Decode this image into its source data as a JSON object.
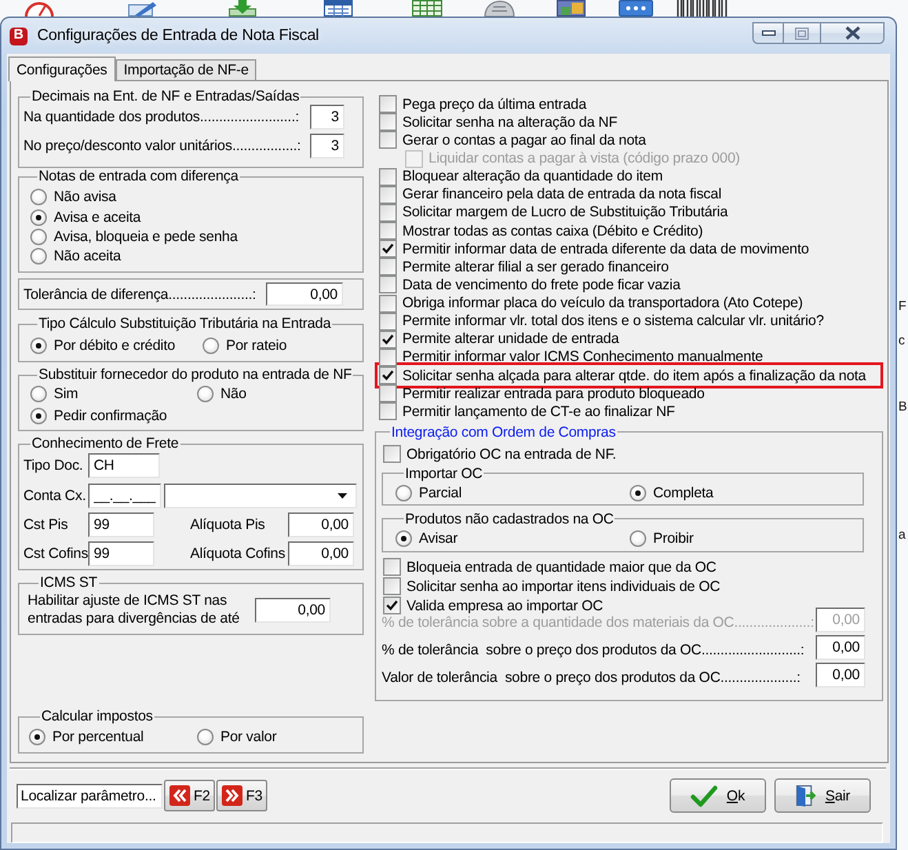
{
  "window": {
    "title": "Configurações de Entrada de Nota Fiscal",
    "logo": "B"
  },
  "background": {
    "fragments": [
      "F",
      "c",
      "B",
      "a"
    ]
  },
  "tabs": [
    {
      "label": "Configurações",
      "selected": true
    },
    {
      "label": "Importação de NF-e",
      "selected": false
    }
  ],
  "decimals": {
    "title": "Decimais na Ent. de NF e Entradas/Saídas",
    "fields": [
      {
        "label": "Na quantidade dos produtos.........................:",
        "value": "3"
      },
      {
        "label": "No preço/desconto valor unitários.................:",
        "value": "3"
      }
    ]
  },
  "difference_notes": {
    "title": "Notas de entrada com diferença",
    "options": [
      {
        "label": "Não avisa",
        "selected": false
      },
      {
        "label": "Avisa e aceita",
        "selected": true
      },
      {
        "label": "Avisa, bloqueia e pede senha",
        "selected": false
      },
      {
        "label": "Não aceita",
        "selected": false
      }
    ]
  },
  "tolerance": {
    "label": "Tolerância de diferença......................:",
    "value": "0,00"
  },
  "st_calculation": {
    "title": "Tipo Cálculo Substituição Tributária na Entrada",
    "options": [
      {
        "label": "Por débito e crédito",
        "selected": true
      },
      {
        "label": "Por rateio",
        "selected": false
      }
    ]
  },
  "supplier_replacement": {
    "title": "Substituir fornecedor do produto na entrada de NF",
    "options": [
      {
        "label": "Sim",
        "selected": false
      },
      {
        "label": "Não",
        "selected": false
      },
      {
        "label": "Pedir confirmação",
        "selected": true
      }
    ]
  },
  "freight": {
    "title": "Conhecimento de Frete",
    "doc_type": {
      "label": "Tipo Doc.",
      "value": "CH"
    },
    "cash_account": {
      "label": "Conta Cx.",
      "value": "__.__.___"
    },
    "taxes": [
      {
        "code_label": "Cst Pis",
        "code": "99",
        "rate_label": "Alíquota Pis",
        "rate": "0,00"
      },
      {
        "code_label": "Cst Cofins",
        "code": "99",
        "rate_label": "Alíquota Cofins",
        "rate": "0,00"
      }
    ]
  },
  "icms_st": {
    "title": "ICMS ST",
    "label": "Habilitar ajuste de ICMS ST nas entradas para divergências de até",
    "value": "0,00"
  },
  "tax_calculation": {
    "title": "Calcular impostos",
    "options": [
      {
        "label": "Por percentual",
        "selected": true
      },
      {
        "label": "Por valor",
        "selected": false
      }
    ]
  },
  "options": [
    {
      "label": "Pega preço da última entrada",
      "checked": false,
      "disabled": false,
      "highlighted": false
    },
    {
      "label": "Solicitar senha na alteração da NF",
      "checked": false,
      "disabled": false,
      "highlighted": false
    },
    {
      "label": "Gerar o contas a pagar ao final da nota",
      "checked": false,
      "disabled": false,
      "highlighted": false,
      "children": [
        {
          "label": "Liquidar contas a pagar à vista (código prazo 000)",
          "checked": false,
          "disabled": true,
          "highlighted": false
        }
      ]
    },
    {
      "label": "Bloquear alteração da quantidade do item",
      "checked": false,
      "disabled": false,
      "highlighted": false
    },
    {
      "label": "Gerar financeiro pela data de entrada da nota fiscal",
      "checked": false,
      "disabled": false,
      "highlighted": false
    },
    {
      "label": "Solicitar margem de Lucro de Substituição Tributária",
      "checked": false,
      "disabled": false,
      "highlighted": false
    },
    {
      "label": "Mostrar todas as contas caixa (Débito e Crédito)",
      "checked": false,
      "disabled": false,
      "highlighted": false
    },
    {
      "label": "Permitir informar data de entrada diferente da data de movimento",
      "checked": true,
      "disabled": false,
      "highlighted": false
    },
    {
      "label": "Permite alterar filial a ser gerado financeiro",
      "checked": false,
      "disabled": false,
      "highlighted": false
    },
    {
      "label": "Data de vencimento do frete pode ficar vazia",
      "checked": false,
      "disabled": false,
      "highlighted": false
    },
    {
      "label": "Obriga informar placa do veículo da transportadora (Ato Cotepe)",
      "checked": false,
      "disabled": false,
      "highlighted": false
    },
    {
      "label": "Permite informar vlr. total dos itens e o sistema calcular vlr. unitário?",
      "checked": false,
      "disabled": false,
      "highlighted": false
    },
    {
      "label": "Permite alterar unidade de entrada",
      "checked": true,
      "disabled": false,
      "highlighted": false
    },
    {
      "label": "Permitir informar valor ICMS Conhecimento manualmente",
      "checked": false,
      "disabled": false,
      "highlighted": false
    },
    {
      "label": "Solicitar senha alçada para alterar qtde. do item após a finalização da nota",
      "checked": true,
      "disabled": false,
      "highlighted": true
    },
    {
      "label": "Permitir realizar entrada para produto bloqueado",
      "checked": false,
      "disabled": false,
      "highlighted": false
    },
    {
      "label": "Permitir lançamento de CT-e ao finalizar NF",
      "checked": false,
      "disabled": false,
      "highlighted": false
    }
  ],
  "purchase_order": {
    "title": "Integração com Ordem de Compras",
    "required": {
      "label": "Obrigatório OC na entrada de NF.",
      "checked": false
    },
    "import_mode": {
      "title": "Importar OC",
      "options": [
        {
          "label": "Parcial",
          "selected": false
        },
        {
          "label": "Completa",
          "selected": true
        }
      ]
    },
    "unregistered_products": {
      "title": "Produtos não cadastrados na OC",
      "options": [
        {
          "label": "Avisar",
          "selected": true
        },
        {
          "label": "Proibir",
          "selected": false
        }
      ]
    },
    "checks": [
      {
        "label": "Bloqueia entrada de quantidade maior que da OC",
        "checked": false
      },
      {
        "label": "Solicitar senha ao importar itens individuais de OC",
        "checked": false
      },
      {
        "label": "Valida empresa ao importar OC",
        "checked": true
      }
    ],
    "tolerances": [
      {
        "label": "% de tolerância sobre a quantidade dos materiais da OC....................:",
        "value": "0,00",
        "disabled": true
      },
      {
        "label": "% de tolerância  sobre o preço dos produtos da OC..........................:",
        "value": "0,00",
        "disabled": false
      },
      {
        "label": "Valor de tolerância  sobre o preço dos produtos da OC....................:",
        "value": "0,00",
        "disabled": false
      }
    ]
  },
  "footer": {
    "search": {
      "placeholder": "Localizar parâmetro..."
    },
    "buttons": [
      {
        "kind": "previous",
        "label": "F2"
      },
      {
        "kind": "next",
        "label": "F3"
      },
      {
        "kind": "confirm",
        "label": "Ok"
      },
      {
        "kind": "exit",
        "label": "Sair"
      }
    ]
  }
}
